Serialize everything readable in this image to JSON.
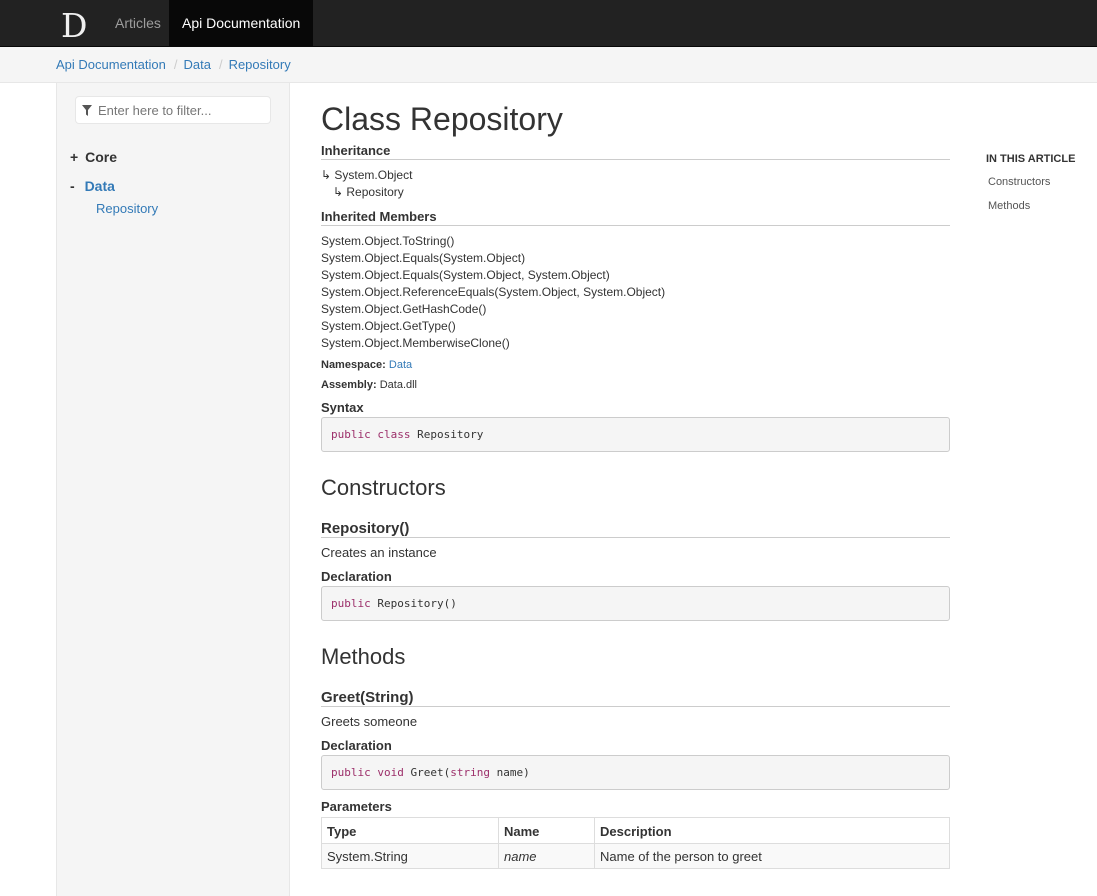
{
  "nav": {
    "logo_letter": "D",
    "items": [
      "Articles",
      "Api Documentation"
    ],
    "active": "Api Documentation"
  },
  "breadcrumb": [
    "Api Documentation",
    "Data",
    "Repository"
  ],
  "sidebar": {
    "filter_placeholder": "Enter here to filter...",
    "tree": [
      {
        "toggle": "+",
        "label": "Core"
      },
      {
        "toggle": "-",
        "label": "Data",
        "children": [
          "Repository"
        ]
      }
    ]
  },
  "article": {
    "title": "Class Repository",
    "inheritance_heading": "Inheritance",
    "inheritance": [
      "System.Object",
      "Repository"
    ],
    "inherited_members_heading": "Inherited Members",
    "inherited_members": [
      "System.Object.ToString()",
      "System.Object.Equals(System.Object)",
      "System.Object.Equals(System.Object, System.Object)",
      "System.Object.ReferenceEquals(System.Object, System.Object)",
      "System.Object.GetHashCode()",
      "System.Object.GetType()",
      "System.Object.MemberwiseClone()"
    ],
    "namespace_label": "Namespace:",
    "namespace": "Data",
    "assembly_label": "Assembly:",
    "assembly": "Data.dll",
    "syntax_heading": "Syntax",
    "syntax": {
      "kw1": "public",
      "kw2": "class",
      "name": "Repository"
    },
    "constructors_heading": "Constructors",
    "constructor": {
      "name": "Repository()",
      "summary": "Creates an instance",
      "declaration_heading": "Declaration",
      "code": {
        "kw1": "public",
        "rest": "Repository()"
      }
    },
    "methods_heading": "Methods",
    "method": {
      "name": "Greet(String)",
      "summary": "Greets someone",
      "declaration_heading": "Declaration",
      "code": {
        "kw1": "public",
        "kw2": "void",
        "name": "Greet(",
        "kw3": "string",
        "rest": "name)"
      },
      "parameters_heading": "Parameters",
      "parameters_columns": [
        "Type",
        "Name",
        "Description"
      ],
      "parameters": [
        {
          "type": "System.String",
          "name": "name",
          "description": "Name of the person to greet"
        }
      ]
    }
  },
  "in_this_article": {
    "title": "IN THIS ARTICLE",
    "links": [
      "Constructors",
      "Methods"
    ]
  }
}
